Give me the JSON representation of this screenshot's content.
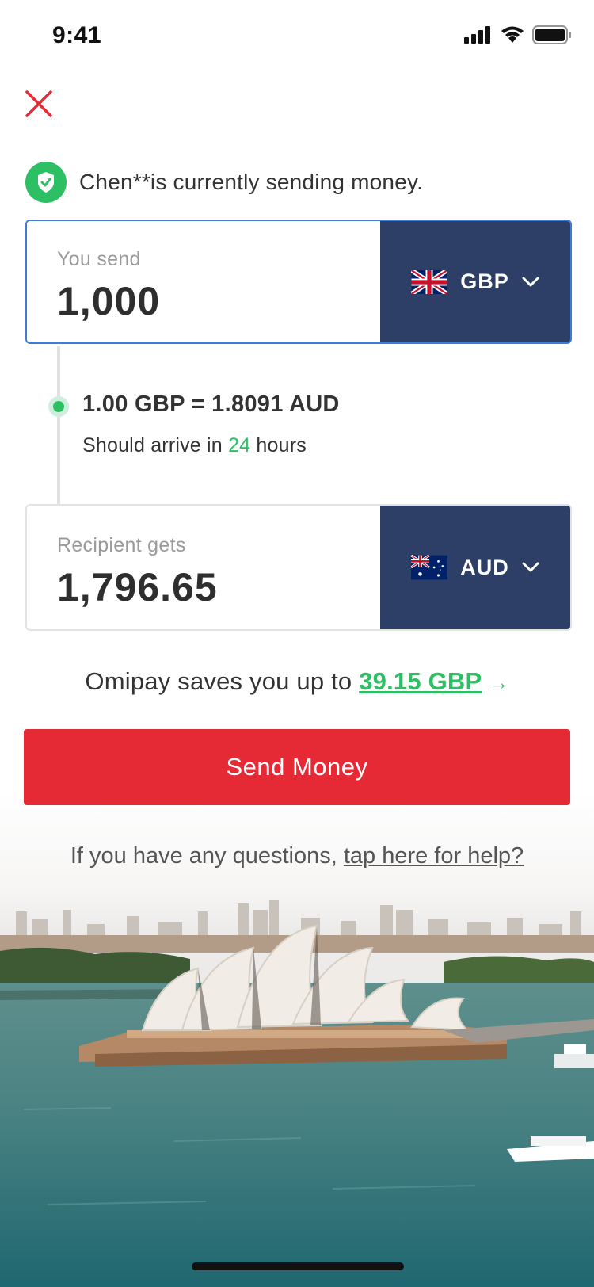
{
  "status_bar": {
    "time": "9:41"
  },
  "notice": {
    "text": "Chen**is currently sending money."
  },
  "send": {
    "label": "You send",
    "amount": "1,000",
    "currency": "GBP"
  },
  "rate": {
    "text": "1.00 GBP = 1.8091 AUD",
    "arrive_prefix": "Should arrive in ",
    "arrive_hours": "24",
    "arrive_suffix": " hours"
  },
  "receive": {
    "label": "Recipient gets",
    "amount": "1,796.65",
    "currency": "AUD"
  },
  "savings": {
    "prefix": "Omipay saves you up to ",
    "amount": "39.15 GBP",
    "arrow": "→"
  },
  "send_button": {
    "label": "Send Money"
  },
  "help": {
    "prefix": "If you have any questions, ",
    "link": "tap here for help?"
  },
  "colors": {
    "accent_red": "#e52a35",
    "navy": "#2d3f66",
    "green": "#2cbf63",
    "focus_blue": "#3f7bd8"
  },
  "icons": [
    "close-icon",
    "shield-check-icon",
    "uk-flag-icon",
    "australia-flag-icon",
    "chevron-down-icon",
    "arrow-right-icon",
    "signal-icon",
    "wifi-icon",
    "battery-icon"
  ]
}
